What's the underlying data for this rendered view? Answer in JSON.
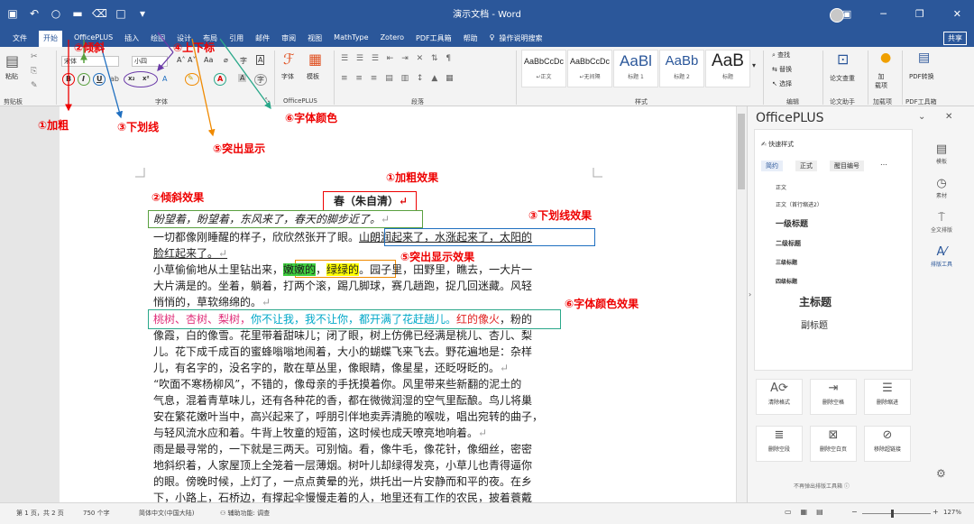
{
  "window": {
    "title": "演示文档 - Word",
    "share": "共享"
  },
  "tabs": [
    "文件",
    "开始",
    "OfficePLUS",
    "插入",
    "绘图",
    "设计",
    "布局",
    "引用",
    "邮件",
    "审阅",
    "视图",
    "MathType",
    "Zotero",
    "PDF工具箱",
    "帮助",
    "操作说明搜索"
  ],
  "ribbon": {
    "paste": "粘贴",
    "font_name": "宋体",
    "font_size": "小四",
    "font_group": "字体",
    "officeplus_group": "OfficePLUS",
    "paragraph_group": "段落",
    "styles_group": "样式",
    "editing_group": "编辑",
    "clipboard_group": "剪贴板",
    "font_tool": "字体",
    "template_tool": "模板",
    "styles": [
      {
        "preview": "AaBbCcDc",
        "label": "↵正文"
      },
      {
        "preview": "AaBbCcDc",
        "label": "↵无间隔"
      },
      {
        "preview": "AaBl",
        "label": "标题 1"
      },
      {
        "preview": "AaBb",
        "label": "标题 2"
      },
      {
        "preview": "AaB",
        "label": "标题"
      }
    ],
    "find": "查找",
    "replace": "替换",
    "select": "选择",
    "check": "论文查重",
    "check_group": "论文助手",
    "addin": "加载项",
    "addin2": "加\n载项",
    "pdf": "PDF转换",
    "pdf_group": "PDF工具箱"
  },
  "annotations": {
    "bold": "①加粗",
    "italic": "②倾斜",
    "underline": "③下划线",
    "supsub": "④上下标",
    "highlight": "⑤突出显示",
    "fontcolor": "⑥字体颜色",
    "bold_effect": "①加粗效果",
    "italic_effect": "②倾斜效果",
    "underline_effect": "③下划线效果",
    "highlight_effect": "⑤突出显示效果",
    "fontcolor_effect": "⑥字体颜色效果"
  },
  "document": {
    "title": "春（朱自清）",
    "l1": "盼望着，盼望着，东风来了，春天的脚步近了。",
    "l2a": "一切都像刚睡醒的样子，欣欣然张开了眼。",
    "l2b": "山朗润起来了，水涨起来了，太阳的",
    "l3": "脸红起来了。",
    "l4a": "小草偷偷地从土里钻出来，",
    "l4b": "嫩嫩的",
    "l4c": "，",
    "l4d": "绿绿的",
    "l4e": "。园子里，田野里，瞧去，一大片一",
    "l5": "大片满是的。坐着，躺着，打两个滚，踢几脚球，赛几趟跑，捉几回迷藏。风轻",
    "l6": "悄悄的，草软绵绵的。",
    "l7a": "桃树、杏树、梨树，",
    "l7b": "你不让我，我不让你，都开满了花赶趟儿。",
    "l7c": "红的像火",
    "l7d": "，粉的",
    "l8": "像霞，白的像雪。花里带着甜味儿；闭了眼，树上仿佛已经满是桃儿、杏儿、梨",
    "l9": "儿。花下成千成百的蜜蜂嗡嗡地闹着，大小的蝴蝶飞来飞去。野花遍地是：杂样",
    "l10": "儿，有名字的，没名字的，散在草丛里，像眼睛，像星星，还眨呀眨的。",
    "l11": "“吹面不寒杨柳风”，不错的，像母亲的手抚摸着你。风里带来些新翻的泥土的",
    "l12": "气息，混着青草味儿，还有各种花的香，都在微微润湿的空气里酝酿。鸟儿将巢",
    "l13": "安在繁花嫩叶当中，高兴起来了，呼朋引伴地卖弄清脆的喉咙，唱出宛转的曲子，",
    "l14": "与轻风流水应和着。牛背上牧童的短笛，这时候也成天嘹亮地响着。",
    "l15": "雨是最寻常的，一下就是三两天。可别恼。看，像牛毛，像花针，像细丝，密密",
    "l16": "地斜织着，人家屋顶上全笼着一层薄烟。树叶儿却绿得发亮，小草儿也青得逼你",
    "l17": "的眼。傍晚时候，上灯了，一点点黄晕的光，烘托出一片安静而和平的夜。在乡",
    "l18": "下，小路上，石桥边，有撑起伞慢慢走着的人，地里还有工作的农民，披着蓑戴"
  },
  "pane": {
    "title": "OfficePLUS",
    "quick_styles": "快速样式",
    "tabs": [
      "简约",
      "正式",
      "醒目编号"
    ],
    "more": "…",
    "items": [
      "正文",
      "正文（首行缩进2）",
      "一级标题",
      "二级标题",
      "三级标题",
      "四级标题",
      "主标题",
      "副标题"
    ],
    "tools": [
      "清除格式",
      "删除空格",
      "删除缩进",
      "删除空段",
      "删除空白页",
      "移除超链接"
    ],
    "footer": "不再弹出排版工具箱 ⓘ",
    "side": [
      "模板",
      "素材",
      "全文排版",
      "排版工具"
    ]
  },
  "status": {
    "page": "第 1 页，共 2 页",
    "words": "750 个字",
    "lang": "简体中文(中国大陆)",
    "access": "辅助功能: 调查",
    "zoom": "127%"
  },
  "colors": {
    "brand": "#2b579a",
    "annotation": "#e00000",
    "green_box": "#5aa040",
    "blue_box": "#1f6fc0",
    "orange": "#f08a00",
    "teal": "#2aa88a",
    "purple": "#6a3aa8",
    "pink": "#e0307a",
    "cyan": "#00a8c8",
    "red_text": "#e02020"
  }
}
